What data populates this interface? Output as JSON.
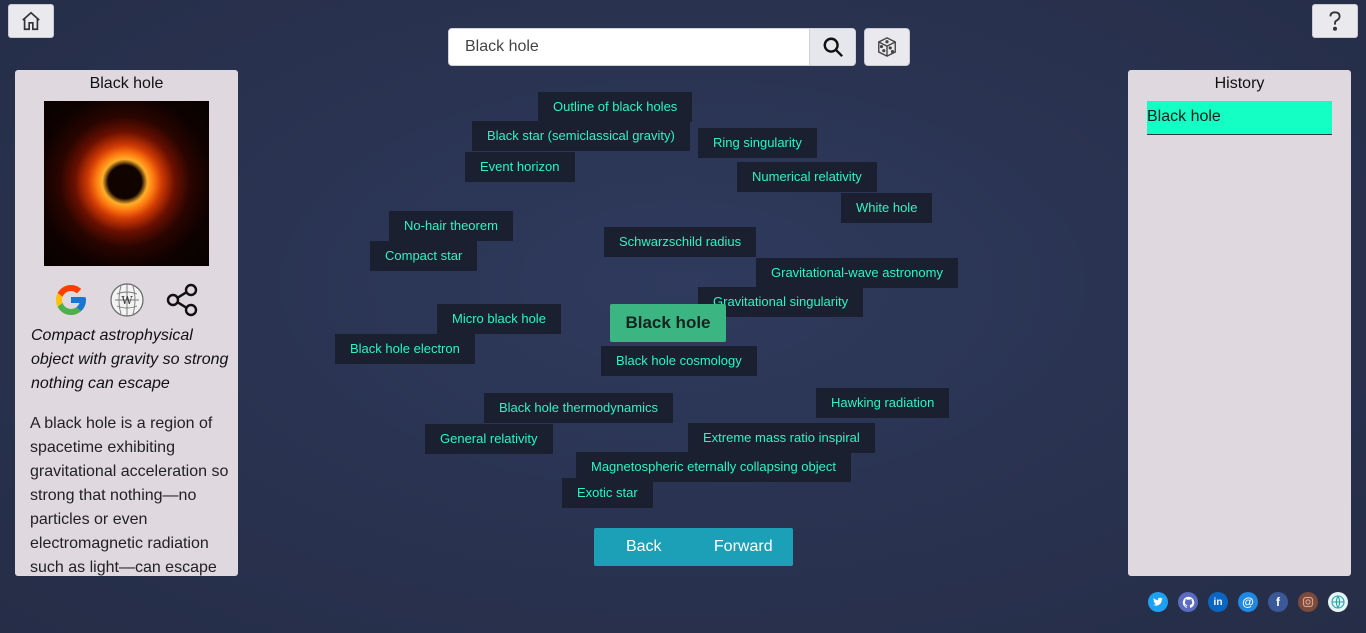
{
  "search": {
    "value": "Black hole"
  },
  "left_panel": {
    "title": "Black hole",
    "summary": "Compact astrophysical object with gravity so strong nothing can escape",
    "body": "A black hole is a region of spacetime exhibiting gravitational acceleration so strong that nothing—no particles or even electromagnetic radiation such as light—can escape"
  },
  "history": {
    "title": "History",
    "items": [
      "Black hole"
    ]
  },
  "graph": {
    "center": "Black hole",
    "nodes": [
      "Outline of black holes",
      "Black star (semiclassical gravity)",
      "Ring singularity",
      "Event horizon",
      "Numerical relativity",
      "White hole",
      "No-hair theorem",
      "Schwarzschild radius",
      "Compact star",
      "Gravitational-wave astronomy",
      "Gravitational singularity",
      "Micro black hole",
      "Black hole electron",
      "Black hole cosmology",
      "Hawking radiation",
      "Black hole thermodynamics",
      "General relativity",
      "Extreme mass ratio inspiral",
      "Magnetospheric eternally collapsing object",
      "Exotic star"
    ]
  },
  "nav": {
    "back": "Back",
    "forward": "Forward"
  },
  "icons": [
    "home-icon",
    "help-icon",
    "search-icon",
    "dice-icon",
    "google-icon",
    "wikipedia-icon",
    "share-icon"
  ],
  "social": [
    "twitter-icon",
    "github-icon",
    "linkedin-icon",
    "email-icon",
    "facebook-icon",
    "instagram-icon",
    "website-icon"
  ],
  "colors": {
    "accent": "#2cf5c2",
    "center_node": "#3bb582",
    "history_highlight": "#13ffc4",
    "nav": "#1ba0b8"
  }
}
